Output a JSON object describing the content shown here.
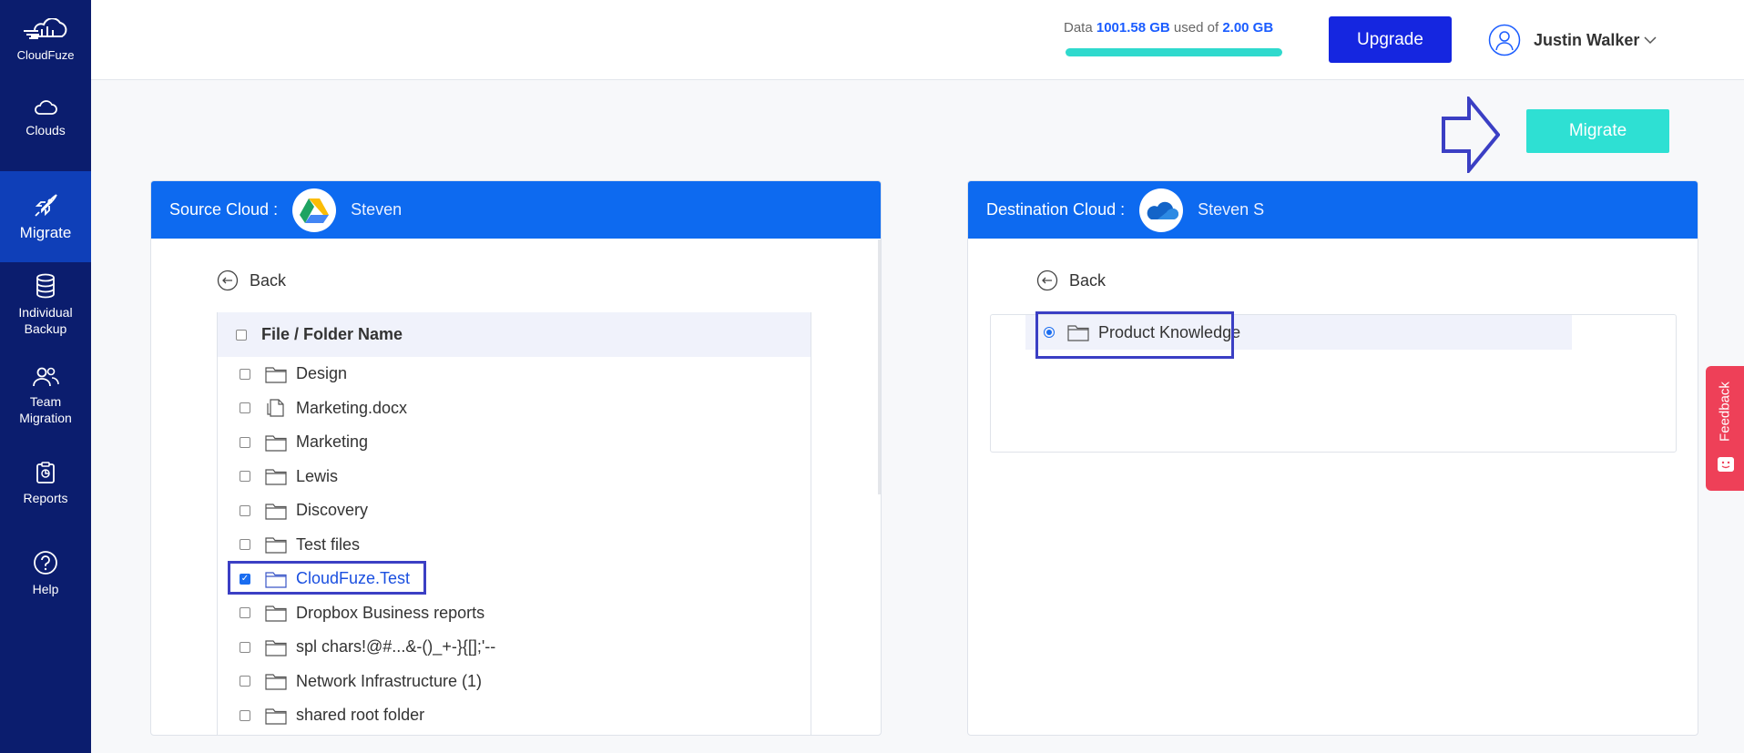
{
  "sidebar": {
    "logo": "CloudFuze",
    "items": [
      {
        "label": "Clouds",
        "icon": "cloud-icon"
      },
      {
        "label": "Migrate",
        "icon": "rocket-icon"
      },
      {
        "label": "Individual Backup",
        "icon": "database-icon"
      },
      {
        "label": "Team Migration",
        "icon": "team-icon"
      },
      {
        "label": "Reports",
        "icon": "clipboard-icon"
      },
      {
        "label": "Help",
        "icon": "help-icon"
      }
    ]
  },
  "header": {
    "usage_prefix": "Data",
    "used": "1001.58 GB",
    "usage_mid": "used of",
    "total": "2.00 GB",
    "usage_fraction": 1.0,
    "upgrade_label": "Upgrade",
    "user_name": "Justin Walker"
  },
  "actions": {
    "migrate_label": "Migrate"
  },
  "source": {
    "title": "Source Cloud :",
    "owner": "Steven",
    "back_label": "Back",
    "column_header": "File / Folder Name",
    "items": [
      {
        "name": "Design",
        "type": "folder",
        "checked": false
      },
      {
        "name": "Marketing.docx",
        "type": "file",
        "checked": false
      },
      {
        "name": "Marketing",
        "type": "folder",
        "checked": false
      },
      {
        "name": "Lewis",
        "type": "folder",
        "checked": false
      },
      {
        "name": "Discovery",
        "type": "folder",
        "checked": false
      },
      {
        "name": "Test files",
        "type": "folder",
        "checked": false
      },
      {
        "name": "CloudFuze.Test",
        "type": "folder",
        "checked": true
      },
      {
        "name": "Dropbox Business reports",
        "type": "folder",
        "checked": false
      },
      {
        "name": "spl chars!@#...&-()_+-}{[];'--",
        "type": "folder",
        "checked": false
      },
      {
        "name": "Network Infrastructure (1)",
        "type": "folder",
        "checked": false
      },
      {
        "name": "shared root folder",
        "type": "folder",
        "checked": false
      }
    ]
  },
  "destination": {
    "title": "Destination Cloud :",
    "owner": "Steven S",
    "back_label": "Back",
    "selected_folder": "Product Knowledge"
  },
  "feedback": {
    "label": "Feedback"
  },
  "colors": {
    "sidebar": "#0b1d6e",
    "accent": "#0d6af0",
    "teal": "#2ee0d3",
    "upgrade": "#1526e0",
    "feedback": "#ee4058",
    "highlight": "#3b3fc4"
  }
}
